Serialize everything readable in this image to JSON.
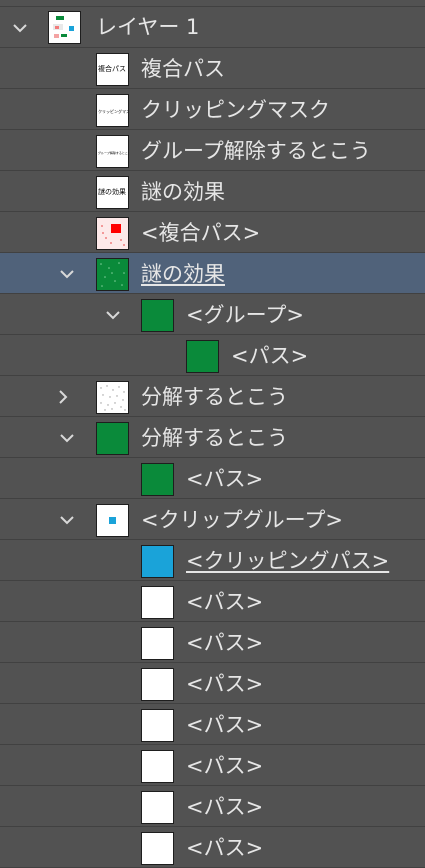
{
  "layer": {
    "name": "レイヤー 1"
  },
  "items": [
    {
      "label": "複合パス",
      "thumb_text": "複合パス"
    },
    {
      "label": "クリッピングマスク",
      "thumb_text": "クリッピングマスク"
    },
    {
      "label": "グループ解除するとこう",
      "thumb_text": "グループ解除するとこう"
    },
    {
      "label": "謎の効果",
      "thumb_text": "謎の効果"
    },
    {
      "label": "<複合パス>"
    },
    {
      "label": "謎の効果"
    },
    {
      "label": "<グループ>"
    },
    {
      "label": "<パス>"
    },
    {
      "label": "分解するとこう"
    },
    {
      "label": "分解するとこう"
    },
    {
      "label": "<パス>"
    },
    {
      "label": "<クリップグループ>"
    },
    {
      "label": "<クリッピングパス>"
    },
    {
      "label": "<パス>"
    },
    {
      "label": "<パス>"
    },
    {
      "label": "<パス>"
    },
    {
      "label": "<パス>"
    },
    {
      "label": "<パス>"
    },
    {
      "label": "<パス>"
    },
    {
      "label": "<パス>"
    }
  ],
  "colors": {
    "green": "#0a8a3a",
    "red": "#ff0000",
    "blue": "#1aa3d9",
    "selected_row": "#50627a"
  }
}
